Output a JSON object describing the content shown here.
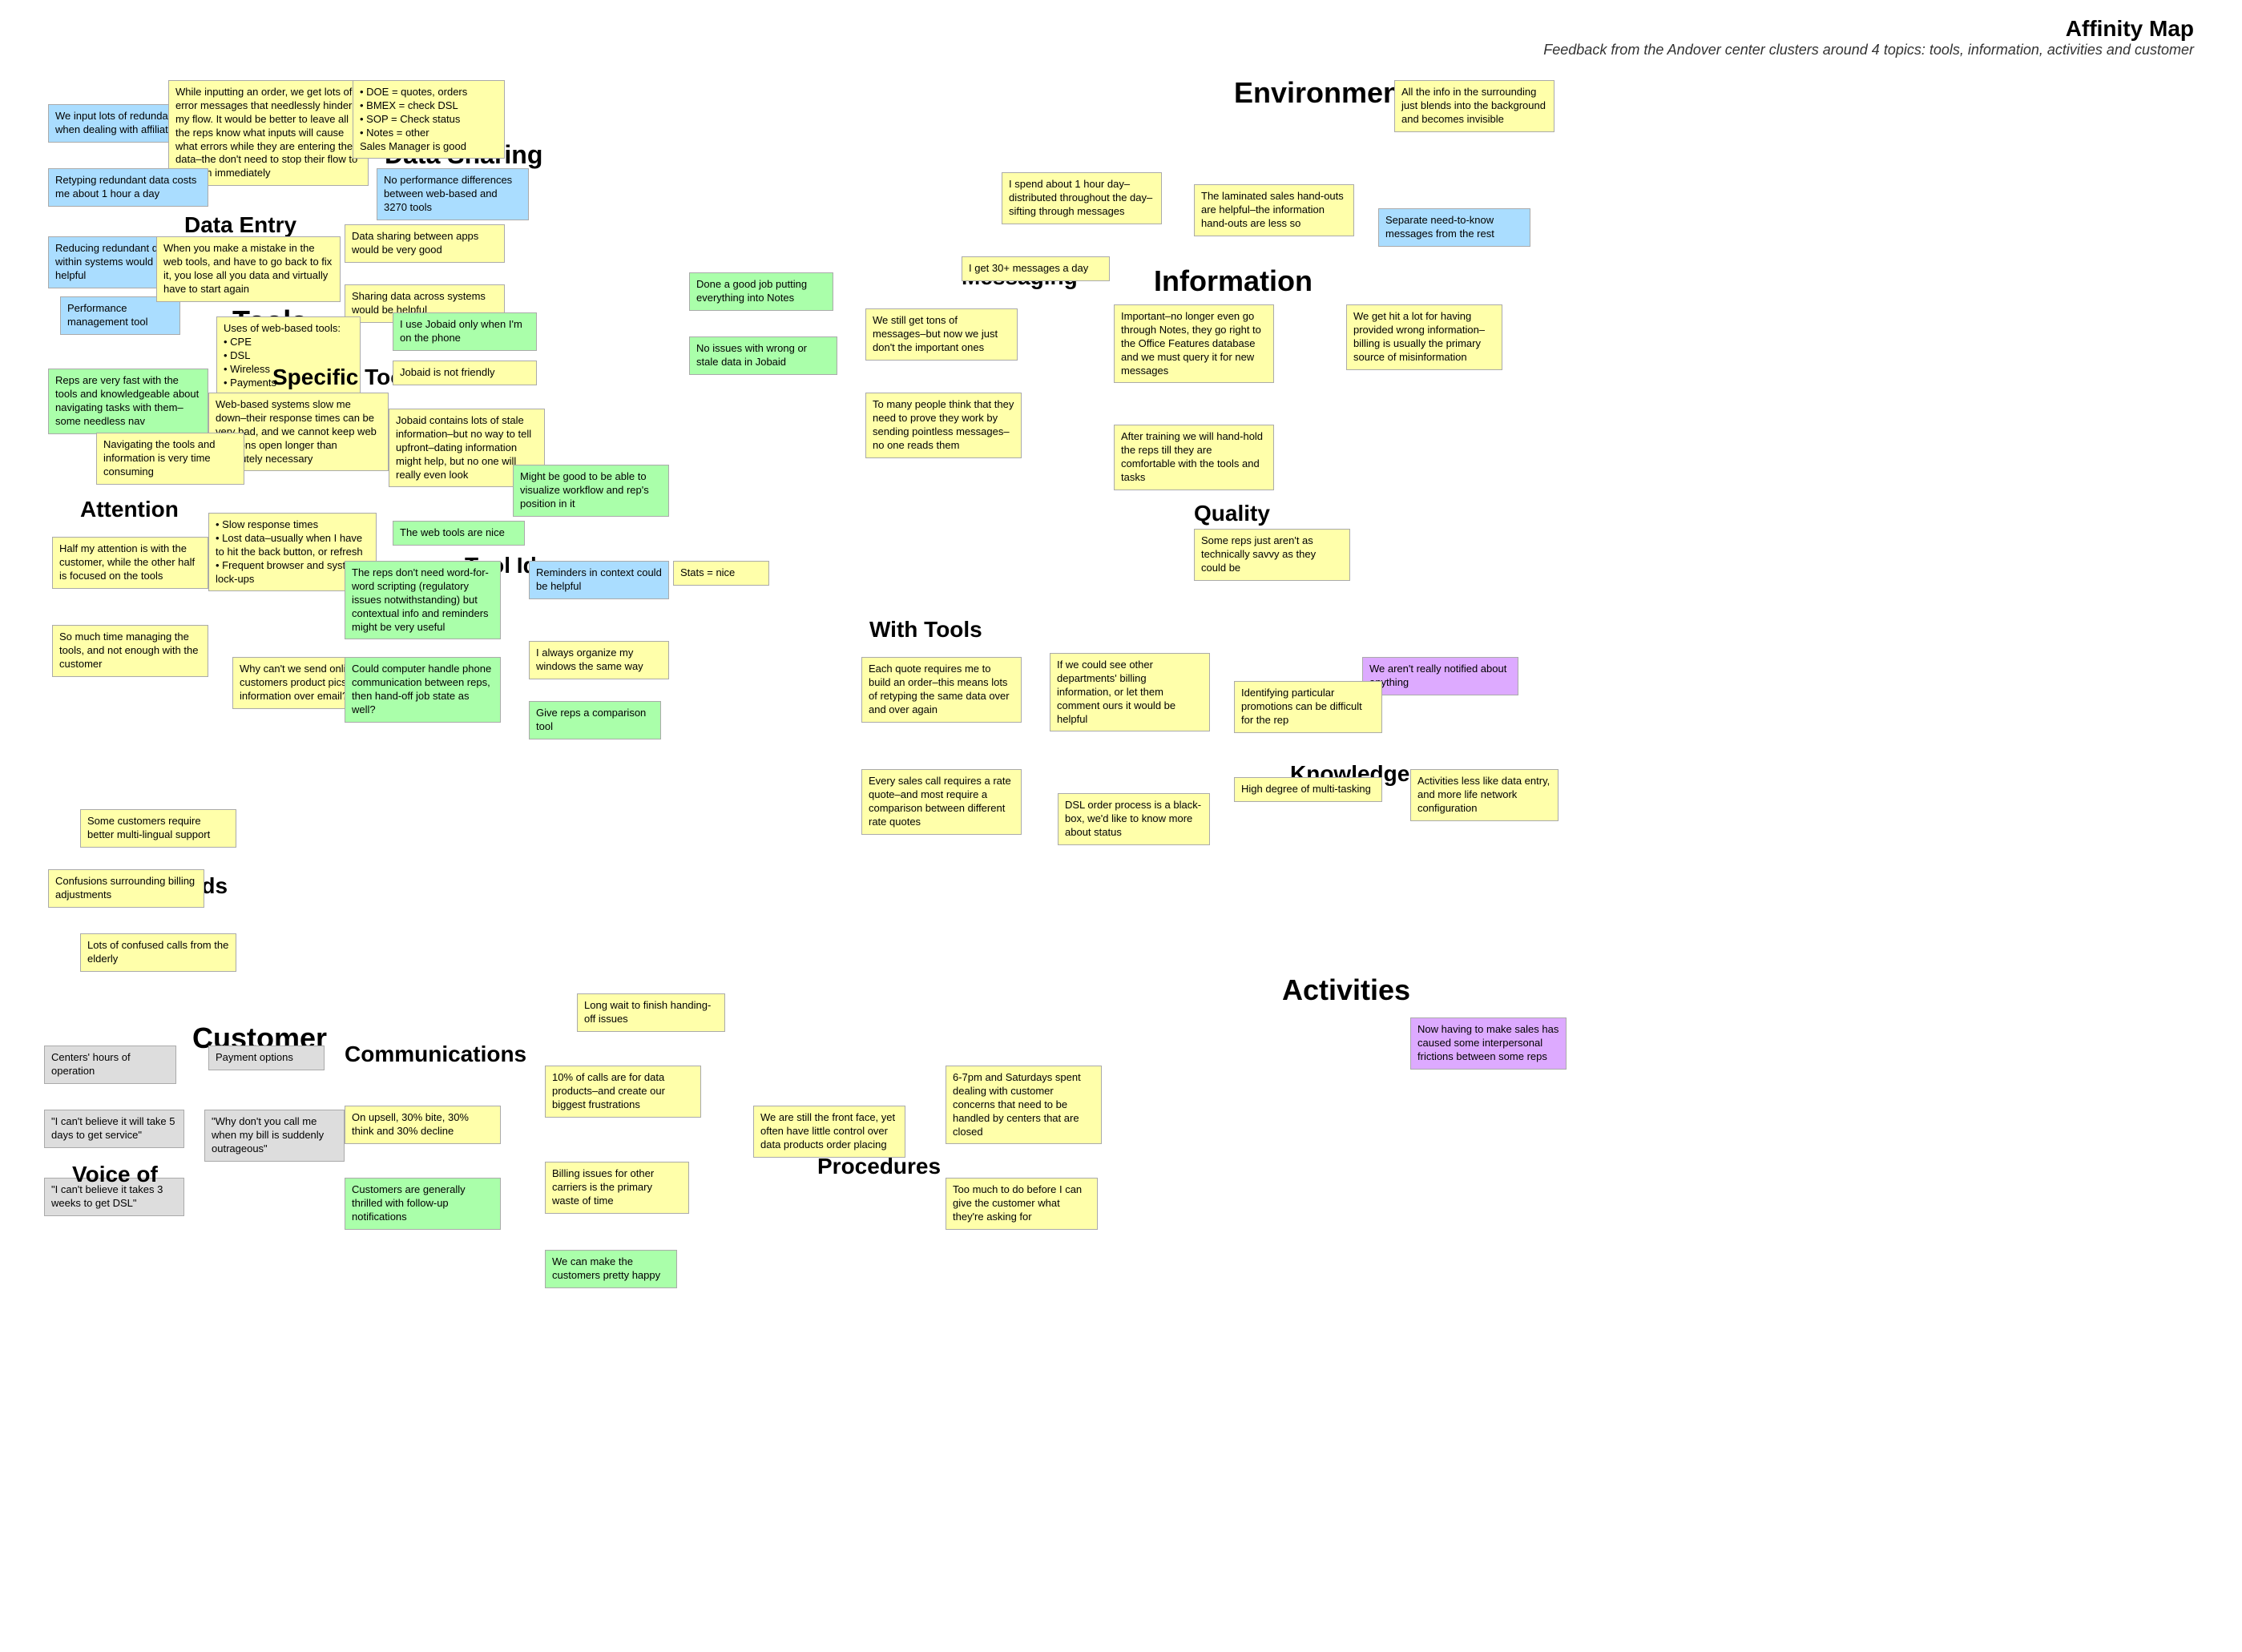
{
  "title": "Affinity Map",
  "subtitle": "Feedback from the Andover center clusters around 4 topics: tools, information, activities and customer",
  "categories": {
    "dataEntry": "Data Entry",
    "dataSharing": "Data Sharing",
    "tools": "Tools",
    "specificTools": "Specific Tools",
    "attention": "Attention",
    "environment": "Environment",
    "messaging": "Messaging",
    "information": "Information",
    "toolIdeas": "Tool Ideas",
    "withTools": "With Tools",
    "quality": "Quality",
    "knowledge": "Knowledge",
    "needs": "Needs",
    "customer": "Customer",
    "communications": "Communications",
    "voiceOf": "Voice of",
    "procedures": "Procedures",
    "activities": "Activities"
  },
  "cards": {
    "c1": "We input lots of redundant data when dealing with affiliates",
    "c2": "While inputting an order, we get lots of error messages that needlessly hinder my flow. It would be better to leave all the reps know what inputs will cause what errors while they are entering the data–the don't need to stop their flow to fix them immediately",
    "c3_bullets": "• DOE = quotes, orders\n• BMEX = check DSL\n• SOP = Check status\n• Notes = other\nSales Manager is good",
    "c4": "No performance differences between web-based and 3270 tools",
    "c5": "Data sharing between apps would be very good",
    "c6": "Sharing data across systems would be helpful",
    "c7": "Retyping redundant data costs me about 1 hour a day",
    "c8": "Reducing redundant data entry within systems would be very helpful",
    "c9": "When you make a mistake in the web tools, and have to go back to fix it, you lose all you data and virtually have to start again",
    "c10": "Uses of web-based tools:\n• CPE\n• DSL\n• Wireless\n• Payments",
    "c11": "Web-based systems slow me down–their response times can be very bad, and we cannot keep web sessions open longer than absolutely necessary",
    "c12_bullets": "• Slow response times\n• Lost data–usually when I have to hit the back button, or refresh\n• Frequent browser and system lock-ups",
    "c13": "I use Jobaid only when I'm on the phone",
    "c14": "Jobaid is not friendly",
    "c15": "Jobaid contains lots of stale information–but no way to tell upfront–dating information might help, but no one will really even look",
    "c16": "The web tools are nice",
    "c17": "Reps are very fast with the tools and knowledgeable about navigating tasks with them–some needless nav",
    "c18": "Navigating the tools and information is very time consuming",
    "c19": "Half my attention is with the customer, while the other half is focused on the tools",
    "c20": "So much time managing the tools, and not enough with the customer",
    "c21": "Performance management tool",
    "c22": "The reps don't need word-for-word scripting (regulatory issues notwithstanding) but contextual info and reminders might be very useful",
    "c23": "Reminders in context could be helpful",
    "c24": "Might be good to be able to visualize workflow and rep's position in it",
    "c25": "Why can't we send online customers product pics and information over email?",
    "c26": "Could computer handle phone communication between reps, then hand-off job state as well?",
    "c27": "I always organize my windows the same way",
    "c28": "Give reps a comparison tool",
    "c29": "Stats = nice",
    "c30": "All the info in the surrounding just blends into the background and becomes invisible",
    "c31": "The laminated sales hand-outs are helpful–the information hand-outs are less so",
    "c32": "I spend about 1 hour day–distributed throughout the day–sifting through messages",
    "c33": "Done a good job putting everything into Notes",
    "c34": "No issues with wrong or stale data in Jobaid",
    "c35": "I get 30+ messages a day",
    "c36": "We still get tons of messages–but now we just don't the important ones",
    "c37": "To many people think that they need to prove they work by sending pointless messages–no one reads them",
    "c38": "Separate need-to-know messages from the rest",
    "c39": "Important–no longer even go through Notes, they go right to the Office Features database and we must query it for new messages",
    "c40": "We get hit a lot for having provided wrong information–billing is usually the primary source of misinformation",
    "c41": "After training we will hand-hold the reps till they are comfortable with the tools and tasks",
    "c42": "Some reps just aren't as technically savvy as they could be",
    "c43": "Each quote requires me to build an order–this means lots of retyping the same data over and over again",
    "c44": "Every sales call requires a rate quote–and most require a comparison between different rate quotes",
    "c45": "If we could see other departments' billing information, or let them comment ours it would be helpful",
    "c46": "We aren't really notified about anything",
    "c47": "Identifying particular promotions can be difficult for the rep",
    "c48": "DSL order process is a black-box, we'd like to know more about status",
    "c49": "High degree of multi-tasking",
    "c50": "Activities less like data entry, and more life network configuration",
    "c51": "Now having to make sales has caused some interpersonal frictions between some reps",
    "c52": "Some customers require better multi-lingual support",
    "c53": "Confusions surrounding billing adjustments",
    "c54": "Lots of confused calls from the elderly",
    "c55": "Centers' hours of operation",
    "c56": "Payment options",
    "c57": "\"I can't believe it will take 5 days to get service\"",
    "c58": "\"Why don't you call me when my bill is suddenly outrageous\"",
    "c59": "On upsell, 30% bite, 30% think and 30% decline",
    "c60": "Customers are generally thrilled with follow-up notifications",
    "c61": "\"I can't believe it takes 3 weeks to get DSL\"",
    "c62": "Long wait to finish handing-off issues",
    "c63": "10% of calls are for data products–and create our biggest frustrations",
    "c64": "Billing issues for other carriers is the primary waste of time",
    "c65": "We can make the customers pretty happy",
    "c66": "We are still the front face, yet often have little control over data products order placing",
    "c67": "6-7pm and Saturdays spent dealing with customer concerns that need to be handled by centers that are closed",
    "c68": "Too much to do before I can give the customer what they're asking for"
  }
}
